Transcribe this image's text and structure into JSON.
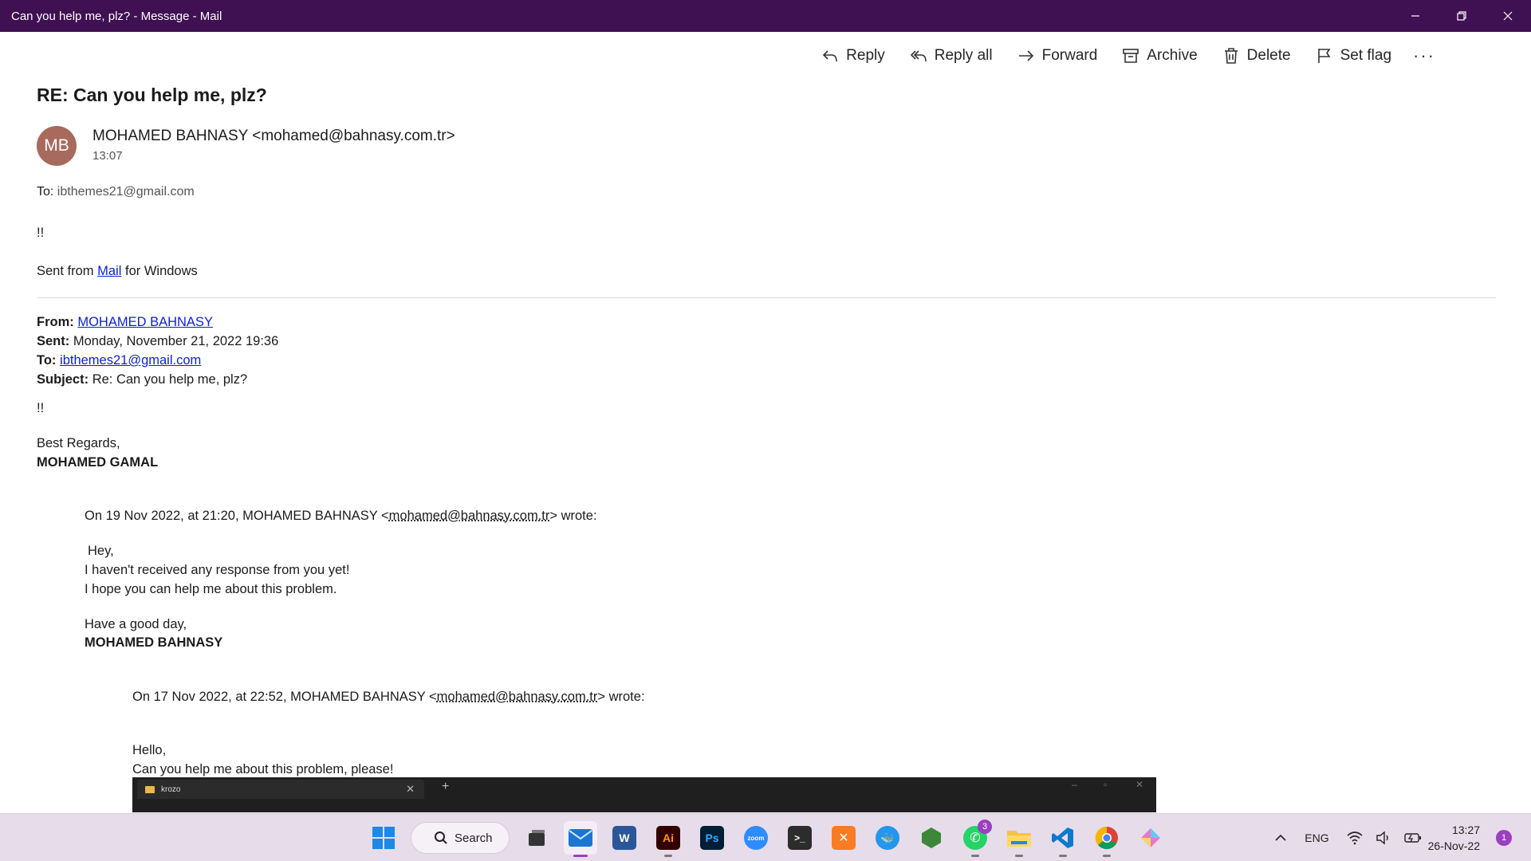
{
  "window": {
    "title": "Can you help me, plz? - Message - Mail"
  },
  "toolbar": {
    "reply": "Reply",
    "reply_all": "Reply all",
    "forward": "Forward",
    "archive": "Archive",
    "delete": "Delete",
    "set_flag": "Set flag",
    "more": "···"
  },
  "message": {
    "subject": "RE: Can you help me, plz?",
    "avatar_initials": "MB",
    "sender": "MOHAMED BAHNASY <mohamed@bahnasy.com.tr>",
    "time": "13:07",
    "to_label": "To:",
    "to": "ibthemes21@gmail.com",
    "body_line1": "!!",
    "sent_from_prefix": "Sent from",
    "sent_from_link": "Mail",
    "sent_from_suffix": "for Windows"
  },
  "quoted": {
    "from_label": "From:",
    "from": "MOHAMED BAHNASY",
    "sent_label": "Sent:",
    "sent": "Monday, November 21, 2022 19:36",
    "to_label": "To:",
    "to": "ibthemes21@gmail.com",
    "subject_label": "Subject:",
    "subject": "Re: Can you help me, plz?",
    "line1": "!!",
    "regards": "Best Regards,",
    "signature": "MOHAMED GAMAL"
  },
  "quote1": {
    "header_prefix": "On 19 Nov 2022, at 21:20, MOHAMED BAHNASY <",
    "header_email": "mohamed@bahnasy.com.tr",
    "header_suffix": "> wrote:",
    "line1": "Hey,",
    "line2": "I haven't received any response from you yet!",
    "line3": "I hope you can help me about this problem.",
    "line4": "Have a good day,",
    "signature": "MOHAMED BAHNASY"
  },
  "quote2": {
    "header_prefix": "On 17 Nov 2022, at 22:52, MOHAMED BAHNASY <",
    "header_email": "mohamed@bahnasy.com.tr",
    "header_suffix": "> wrote:",
    "line1": "Hello,",
    "line2": "Can you help me about this problem, please!"
  },
  "embedded_screenshot": {
    "tab_label": "krozo",
    "tab_close": "✕",
    "new_tab": "+"
  },
  "taskbar": {
    "search_label": "Search",
    "whatsapp_badge": "3",
    "language": "ENG",
    "time": "13:27",
    "date": "26-Nov-22",
    "notifications": "1"
  },
  "colors": {
    "titlebar": "#3f1152",
    "link": "#0b1fd6",
    "avatar": "#a86a5c",
    "taskbar": "#e7dcea",
    "accent": "#9b3fc1"
  }
}
